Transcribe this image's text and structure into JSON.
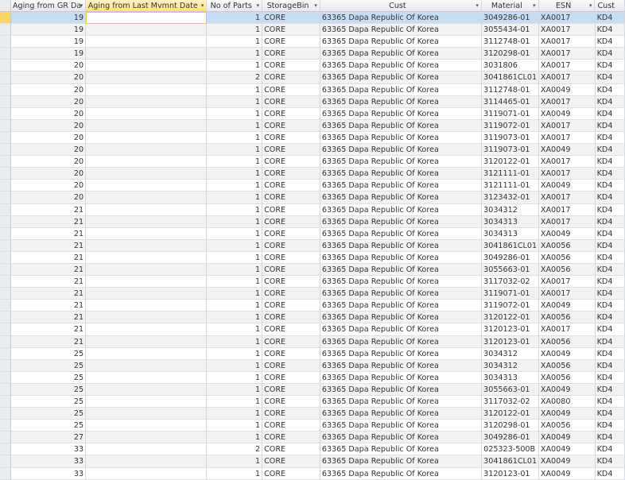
{
  "columns": [
    "Aging from GR Da",
    "Aging from Last Mvmnt Date",
    "No of Parts",
    "StorageBin",
    "Cust",
    "Material",
    "ESN",
    "Cust"
  ],
  "sort_icon": "dropdown-arrow-icon",
  "colors": {
    "selected_row": "#c7ddf4",
    "current_cell_border": "#f0c64a",
    "alt_row": "#f2f2f2"
  },
  "rows": [
    [
      "19",
      "",
      "1",
      "CORE",
      "63365 Dapa Republic Of Korea",
      "3049286-01",
      "XA0017",
      "KD4"
    ],
    [
      "19",
      "",
      "1",
      "CORE",
      "63365 Dapa Republic Of Korea",
      "3055434-01",
      "XA0017",
      "KD4"
    ],
    [
      "19",
      "",
      "1",
      "CORE",
      "63365 Dapa Republic Of Korea",
      "3112748-01",
      "XA0017",
      "KD4"
    ],
    [
      "19",
      "",
      "1",
      "CORE",
      "63365 Dapa Republic Of Korea",
      "3120298-01",
      "XA0017",
      "KD4"
    ],
    [
      "20",
      "",
      "1",
      "CORE",
      "63365 Dapa Republic Of Korea",
      "3031806",
      "XA0017",
      "KD4"
    ],
    [
      "20",
      "",
      "2",
      "CORE",
      "63365 Dapa Republic Of Korea",
      "3041861CL01",
      "XA0017",
      "KD4"
    ],
    [
      "20",
      "",
      "1",
      "CORE",
      "63365 Dapa Republic Of Korea",
      "3112748-01",
      "XA0049",
      "KD4"
    ],
    [
      "20",
      "",
      "1",
      "CORE",
      "63365 Dapa Republic Of Korea",
      "3114465-01",
      "XA0017",
      "KD4"
    ],
    [
      "20",
      "",
      "1",
      "CORE",
      "63365 Dapa Republic Of Korea",
      "3119071-01",
      "XA0049",
      "KD4"
    ],
    [
      "20",
      "",
      "1",
      "CORE",
      "63365 Dapa Republic Of Korea",
      "3119072-01",
      "XA0017",
      "KD4"
    ],
    [
      "20",
      "",
      "1",
      "CORE",
      "63365 Dapa Republic Of Korea",
      "3119073-01",
      "XA0017",
      "KD4"
    ],
    [
      "20",
      "",
      "1",
      "CORE",
      "63365 Dapa Republic Of Korea",
      "3119073-01",
      "XA0049",
      "KD4"
    ],
    [
      "20",
      "",
      "1",
      "CORE",
      "63365 Dapa Republic Of Korea",
      "3120122-01",
      "XA0017",
      "KD4"
    ],
    [
      "20",
      "",
      "1",
      "CORE",
      "63365 Dapa Republic Of Korea",
      "3121111-01",
      "XA0017",
      "KD4"
    ],
    [
      "20",
      "",
      "1",
      "CORE",
      "63365 Dapa Republic Of Korea",
      "3121111-01",
      "XA0049",
      "KD4"
    ],
    [
      "20",
      "",
      "1",
      "CORE",
      "63365 Dapa Republic Of Korea",
      "3123432-01",
      "XA0017",
      "KD4"
    ],
    [
      "21",
      "",
      "1",
      "CORE",
      "63365 Dapa Republic Of Korea",
      "3034312",
      "XA0017",
      "KD4"
    ],
    [
      "21",
      "",
      "1",
      "CORE",
      "63365 Dapa Republic Of Korea",
      "3034313",
      "XA0017",
      "KD4"
    ],
    [
      "21",
      "",
      "1",
      "CORE",
      "63365 Dapa Republic Of Korea",
      "3034313",
      "XA0049",
      "KD4"
    ],
    [
      "21",
      "",
      "1",
      "CORE",
      "63365 Dapa Republic Of Korea",
      "3041861CL01",
      "XA0056",
      "KD4"
    ],
    [
      "21",
      "",
      "1",
      "CORE",
      "63365 Dapa Republic Of Korea",
      "3049286-01",
      "XA0056",
      "KD4"
    ],
    [
      "21",
      "",
      "1",
      "CORE",
      "63365 Dapa Republic Of Korea",
      "3055663-01",
      "XA0056",
      "KD4"
    ],
    [
      "21",
      "",
      "1",
      "CORE",
      "63365 Dapa Republic Of Korea",
      "3117032-02",
      "XA0017",
      "KD4"
    ],
    [
      "21",
      "",
      "1",
      "CORE",
      "63365 Dapa Republic Of Korea",
      "3119071-01",
      "XA0017",
      "KD4"
    ],
    [
      "21",
      "",
      "1",
      "CORE",
      "63365 Dapa Republic Of Korea",
      "3119072-01",
      "XA0049",
      "KD4"
    ],
    [
      "21",
      "",
      "1",
      "CORE",
      "63365 Dapa Republic Of Korea",
      "3120122-01",
      "XA0056",
      "KD4"
    ],
    [
      "21",
      "",
      "1",
      "CORE",
      "63365 Dapa Republic Of Korea",
      "3120123-01",
      "XA0017",
      "KD4"
    ],
    [
      "21",
      "",
      "1",
      "CORE",
      "63365 Dapa Republic Of Korea",
      "3120123-01",
      "XA0056",
      "KD4"
    ],
    [
      "25",
      "",
      "1",
      "CORE",
      "63365 Dapa Republic Of Korea",
      "3034312",
      "XA0049",
      "KD4"
    ],
    [
      "25",
      "",
      "1",
      "CORE",
      "63365 Dapa Republic Of Korea",
      "3034312",
      "XA0056",
      "KD4"
    ],
    [
      "25",
      "",
      "1",
      "CORE",
      "63365 Dapa Republic Of Korea",
      "3034313",
      "XA0056",
      "KD4"
    ],
    [
      "25",
      "",
      "1",
      "CORE",
      "63365 Dapa Republic Of Korea",
      "3055663-01",
      "XA0049",
      "KD4"
    ],
    [
      "25",
      "",
      "1",
      "CORE",
      "63365 Dapa Republic Of Korea",
      "3117032-02",
      "XA0080",
      "KD4"
    ],
    [
      "25",
      "",
      "1",
      "CORE",
      "63365 Dapa Republic Of Korea",
      "3120122-01",
      "XA0049",
      "KD4"
    ],
    [
      "25",
      "",
      "1",
      "CORE",
      "63365 Dapa Republic Of Korea",
      "3120298-01",
      "XA0056",
      "KD4"
    ],
    [
      "27",
      "",
      "1",
      "CORE",
      "63365 Dapa Republic Of Korea",
      "3049286-01",
      "XA0049",
      "KD4"
    ],
    [
      "33",
      "",
      "2",
      "CORE",
      "63365 Dapa Republic Of Korea",
      "025323-500B",
      "XA0049",
      "KD4"
    ],
    [
      "33",
      "",
      "1",
      "CORE",
      "63365 Dapa Republic Of Korea",
      "3041861CL01",
      "XA0049",
      "KD4"
    ],
    [
      "33",
      "",
      "1",
      "CORE",
      "63365 Dapa Republic Of Korea",
      "3120123-01",
      "XA0049",
      "KD4"
    ]
  ]
}
